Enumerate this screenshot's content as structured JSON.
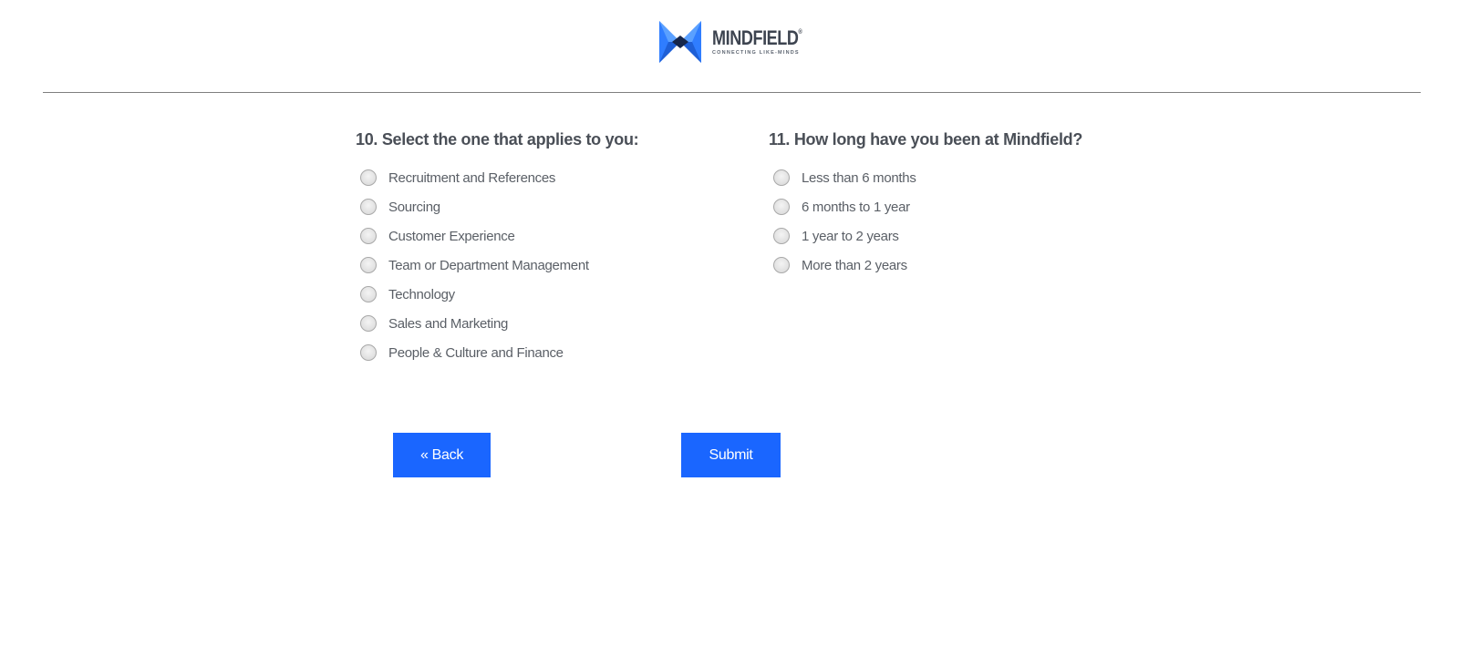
{
  "brand": {
    "name": "MINDFIELD",
    "registered_mark": "®",
    "tagline": "CONNECTING LIKE-MINDS",
    "colors": {
      "logo_blue_light": "#3d8bff",
      "logo_blue_dark": "#1f4fbf",
      "logo_text": "#3d4450"
    }
  },
  "questions": [
    {
      "title": "10. Select the one that applies to you:",
      "options": [
        "Recruitment and References",
        "Sourcing",
        "Customer Experience",
        "Team or Department Management",
        "Technology",
        "Sales and Marketing",
        "People & Culture and Finance"
      ]
    },
    {
      "title": "11. How long have you been at Mindfield?",
      "options": [
        "Less than 6 months",
        "6 months to 1 year",
        "1 year to 2 years",
        "More than 2 years"
      ]
    }
  ],
  "buttons": {
    "back_label": "« Back",
    "submit_label": "Submit",
    "color": "#1a66ff"
  }
}
